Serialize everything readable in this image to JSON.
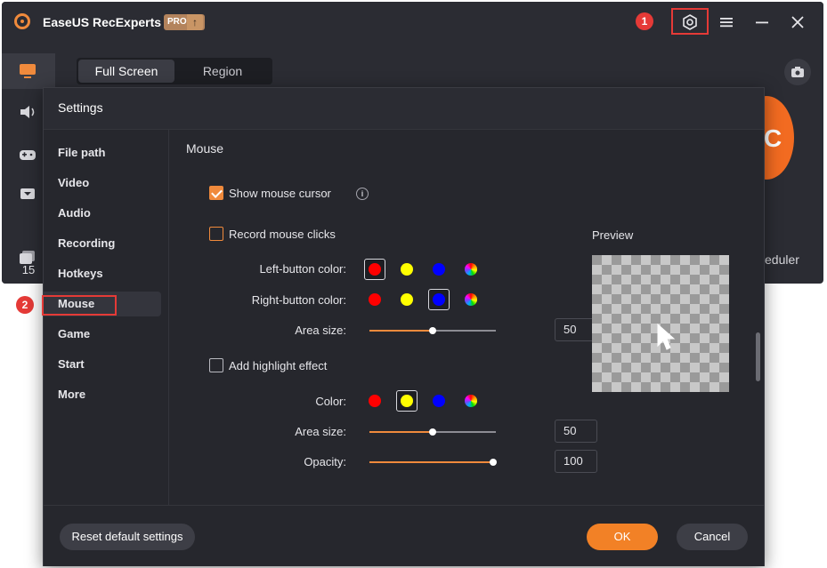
{
  "app": {
    "title": "EaseUS RecExperts",
    "pro_badge": "PRO",
    "markers": {
      "first": "1",
      "second": "2"
    },
    "mode_tabs": [
      "Full Screen",
      "Region"
    ],
    "rec_text": "C",
    "scheduler_text": "eduler",
    "rail_count": "15",
    "icons": {
      "logo": "easeus-logo-icon",
      "settings": "gear-icon",
      "menu": "hamburger-menu-icon",
      "minimize": "minimize-icon",
      "close": "close-icon",
      "camera": "camera-icon"
    },
    "colors": {
      "accent": "#f08a3c",
      "marker": "#e53a37",
      "rec": "#f26b21"
    }
  },
  "settings": {
    "title": "Settings",
    "nav": [
      "File path",
      "Video",
      "Audio",
      "Recording",
      "Hotkeys",
      "Mouse",
      "Game",
      "Start",
      "More"
    ],
    "active_nav": "Mouse",
    "section_title": "Mouse",
    "show_cursor": {
      "label": "Show mouse cursor",
      "checked": true
    },
    "record_clicks": {
      "label": "Record mouse clicks",
      "checked": false
    },
    "left_button_color": {
      "label": "Left-button color:",
      "options": [
        "#ff0000",
        "#ffff00",
        "#0000ff",
        "rainbow"
      ],
      "selected": "#ff0000"
    },
    "right_button_color": {
      "label": "Right-button color:",
      "options": [
        "#ff0000",
        "#ffff00",
        "#0000ff",
        "rainbow"
      ],
      "selected": "#0000ff"
    },
    "click_area_size": {
      "label": "Area size:",
      "value": "50",
      "level": 0.5
    },
    "highlight": {
      "label": "Add highlight effect",
      "checked": false
    },
    "highlight_color": {
      "label": "Color:",
      "options": [
        "#ff0000",
        "#ffff00",
        "#0000ff",
        "rainbow"
      ],
      "selected": "#ffff00"
    },
    "highlight_area_size": {
      "label": "Area size:",
      "value": "50",
      "level": 0.5
    },
    "opacity": {
      "label": "Opacity:",
      "value": "100",
      "level": 1.0
    },
    "preview_label": "Preview",
    "buttons": {
      "reset": "Reset default settings",
      "ok": "OK",
      "cancel": "Cancel"
    }
  }
}
